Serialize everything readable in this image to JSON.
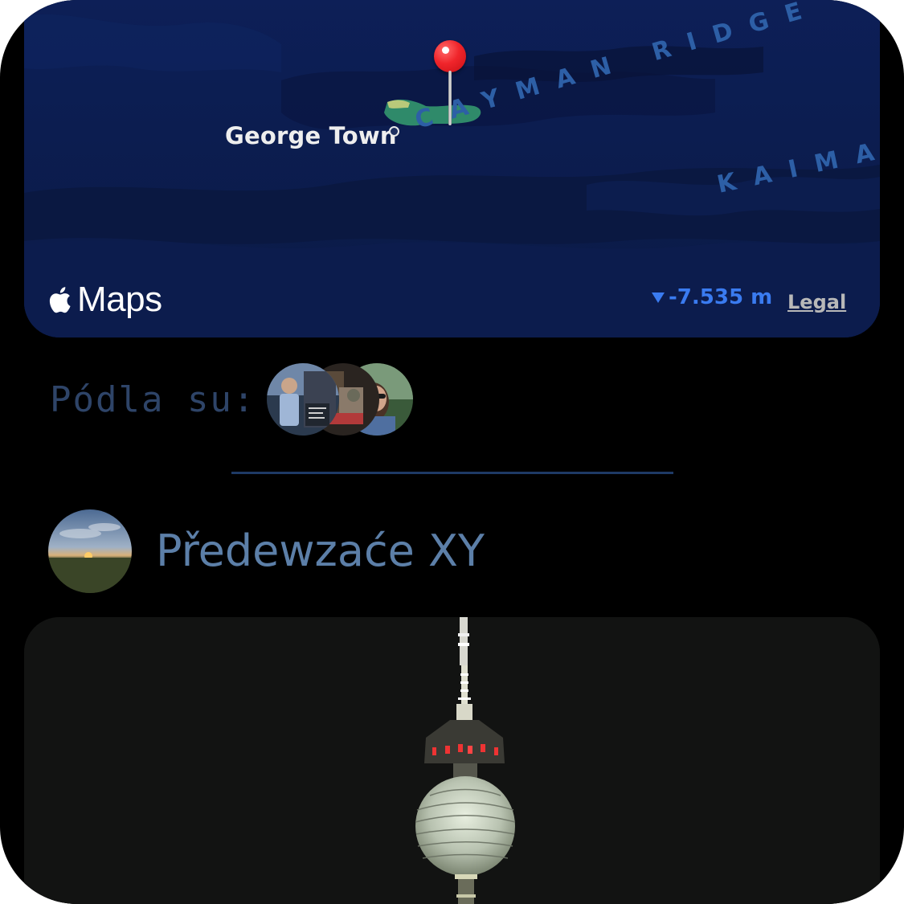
{
  "map": {
    "place_label": "George Town",
    "region_label_1": "CAYMAN RIDGE",
    "region_label_2": "KAIMA",
    "brand": "Maps",
    "depth": "-7.535 m",
    "legal": "Legal",
    "icons": [
      "apple-icon",
      "location-pin-icon",
      "down-arrow-icon"
    ]
  },
  "people": {
    "label": "Pódla su:",
    "avatars": [
      "avatar-person-1",
      "avatar-person-2",
      "avatar-person-3"
    ]
  },
  "profile": {
    "name": "Předewzaće XY"
  },
  "photo": {
    "subject": "tv-tower-photo"
  },
  "colors": {
    "background": "#000000",
    "map_water": "#0b1b4a",
    "pin_red": "#f0252b",
    "depth_blue": "#3a7bf0",
    "label_muted": "#2e4468",
    "profile_name": "#5c7fa8",
    "divider": "#1e3a66"
  }
}
